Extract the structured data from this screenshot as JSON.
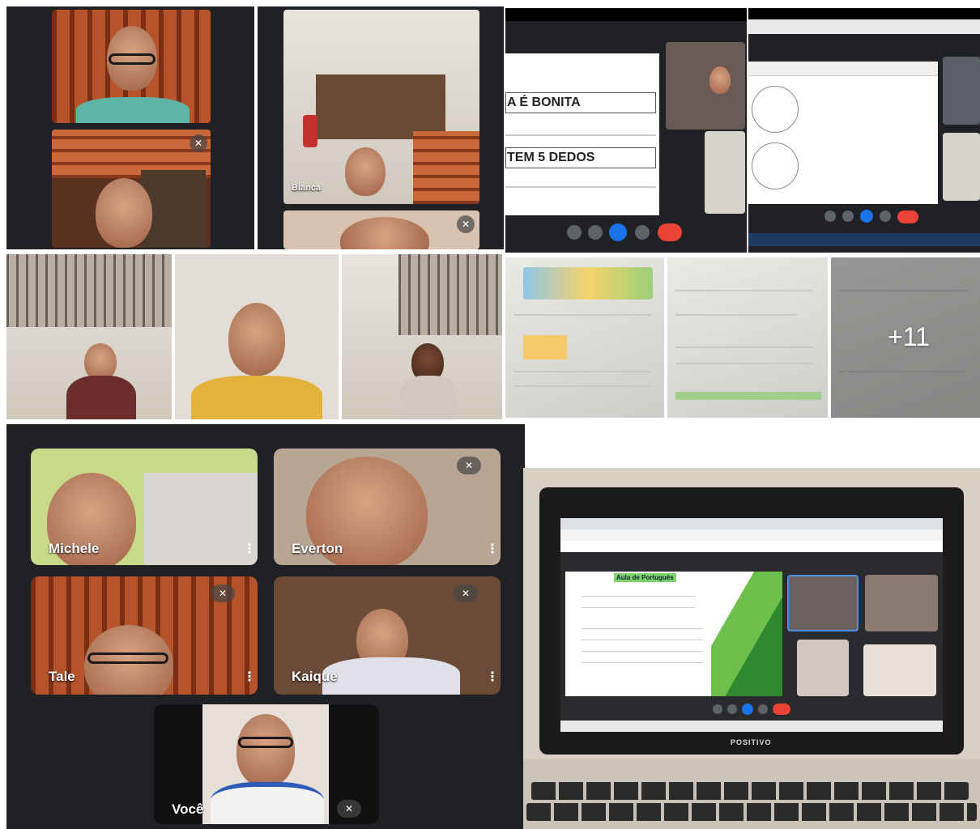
{
  "top_left": {
    "participant_bianca": "Bianca"
  },
  "slides": {
    "line1": "A É BONITA",
    "line2": "TEM 5 DEDOS"
  },
  "gallery": {
    "more_count": "+11"
  },
  "meet_grid": {
    "participants": [
      {
        "name": "Michele"
      },
      {
        "name": "Everton"
      },
      {
        "name": "Tale"
      },
      {
        "name": "Kaique"
      }
    ],
    "self_label": "Você"
  },
  "laptop": {
    "slide_title": "Aula de Português",
    "brand": "POSITIVO"
  },
  "colors": {
    "meet_bg": "#202124",
    "end_call_red": "#ea4335",
    "accent_blue": "#1a73e8",
    "slide_green": "#3a9b3a"
  },
  "icons": {
    "mute": "mic-off-icon",
    "more": "more-vert-icon",
    "end_call": "phone-hangup-icon"
  }
}
